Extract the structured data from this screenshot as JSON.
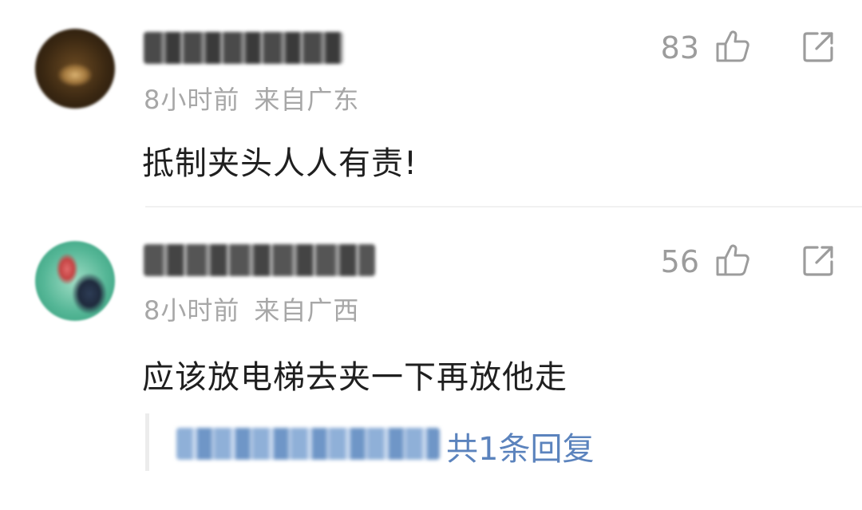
{
  "comments": [
    {
      "username": "",
      "time": "8小时前",
      "location": "来自广东",
      "text": "抵制夹头人人有责!",
      "likes": "83"
    },
    {
      "username": "",
      "time": "8小时前",
      "location": "来自广西",
      "text": "应该放电梯去夹一下再放他走",
      "likes": "56",
      "reply_summary": "共1条回复"
    }
  ],
  "icons": {
    "like": "thumbs-up-icon",
    "share": "share-icon"
  },
  "colors": {
    "meta_text": "#a7a7a7",
    "body_text": "#1f1f1f",
    "icon_gray": "#9c9c9c",
    "reply_link": "#5b83bd"
  }
}
